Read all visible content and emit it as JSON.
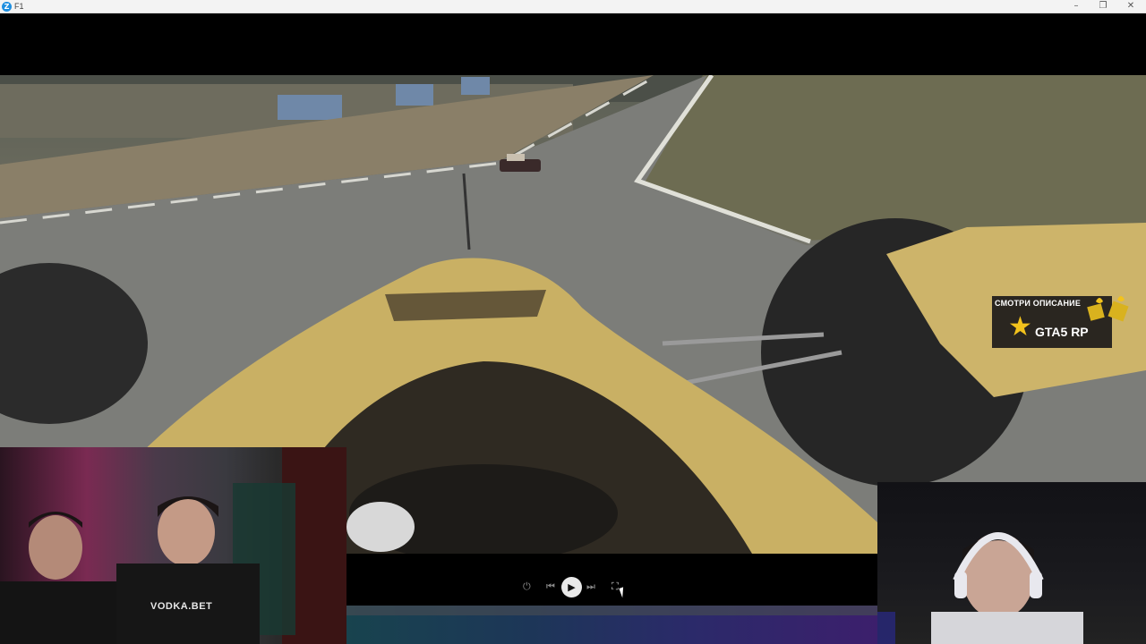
{
  "window": {
    "app_icon_letter": "Z",
    "title": "F1",
    "minimize_glyph": "–",
    "maximize_glyph": "❐",
    "close_glyph": "✕"
  },
  "promo": {
    "caption": "СМОТРИ ОПИСАНИЕ",
    "star_glyph": "★",
    "logo_text": "GTA5 RP"
  },
  "webcam_left": {
    "shirt_text": "VODKA.BET"
  },
  "player": {
    "power_icon": "⏻",
    "prev_icon": "⏮",
    "play_icon": "▶",
    "next_icon": "⏭",
    "fullscreen_icon": "⛶"
  },
  "colors": {
    "car_nose": "#c9b064",
    "accent_gold": "#f2c21c",
    "titlebar": "#f3f3f3"
  }
}
